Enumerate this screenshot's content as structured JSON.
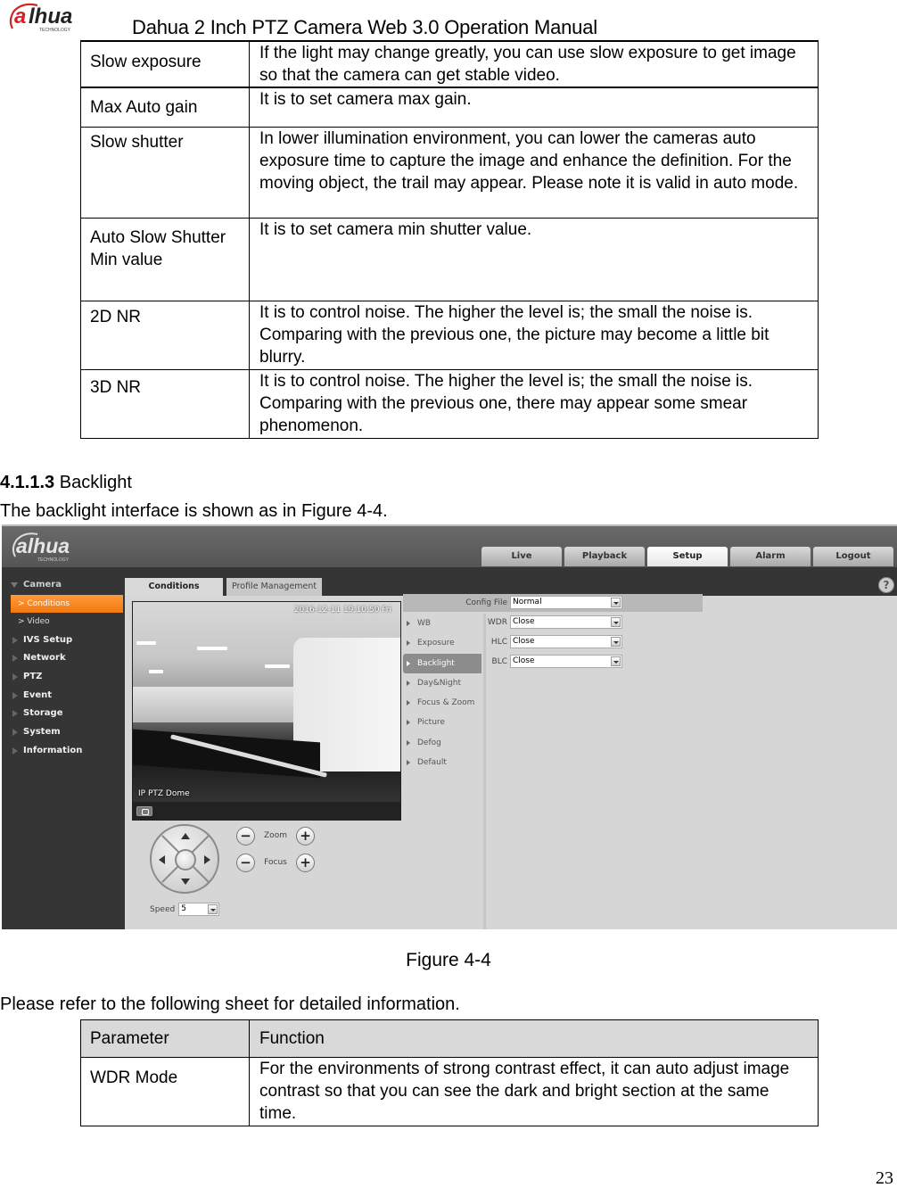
{
  "document": {
    "brand": "alhua",
    "brand_tagline": "TECHNOLOGY",
    "title": "Dahua 2 Inch PTZ Camera Web 3.0 Operation Manual",
    "page_number": "23"
  },
  "table_top": {
    "rows": [
      {
        "parameter": "Slow exposure",
        "function": "If the light may change greatly, you can use slow exposure to get image so that the camera can get stable video."
      },
      {
        "parameter": "Max Auto gain",
        "function": "It is to set camera max gain."
      },
      {
        "parameter": "Slow shutter",
        "function": "In lower illumination environment, you can lower the cameras auto exposure time to capture the image and enhance the definition. For the moving object, the trail may appear. Please note it is valid in auto mode."
      },
      {
        "parameter": "Auto Slow Shutter Min value",
        "function": "It is to set camera min shutter value."
      },
      {
        "parameter": "2D NR",
        "function": "It is to control noise. The higher the level is; the small the noise is. Comparing with the previous one, the picture may become a little bit blurry."
      },
      {
        "parameter": "3D NR",
        "function": "It is to control noise. The higher the level is; the small the noise is. Comparing with the previous one, there may appear some smear phenomenon."
      }
    ]
  },
  "section": {
    "number": "4.1.1.3",
    "title": "Backlight",
    "intro": "The backlight interface is shown as in Figure 4-4."
  },
  "figure": {
    "caption": "Figure 4-4",
    "app": {
      "logo": "alhua",
      "logo_tagline": "TECHNOLOGY",
      "nav_tabs": [
        {
          "label": "Live",
          "active": false
        },
        {
          "label": "Playback",
          "active": false
        },
        {
          "label": "Setup",
          "active": true
        },
        {
          "label": "Alarm",
          "active": false
        },
        {
          "label": "Logout",
          "active": false
        }
      ],
      "help_icon": "?",
      "sidebar": {
        "camera": "Camera",
        "camera_sub": [
          {
            "label": "Conditions",
            "active": true
          },
          {
            "label": "Video",
            "active": false
          }
        ],
        "items": [
          "IVS Setup",
          "Network",
          "PTZ",
          "Event",
          "Storage",
          "System",
          "Information"
        ]
      },
      "sub_tabs": [
        {
          "label": "Conditions",
          "active": true
        },
        {
          "label": "Profile Management",
          "active": false
        }
      ],
      "video": {
        "timestamp": "2016-12-11 19:10:50 Fri",
        "channel_label": "IP PTZ Dome"
      },
      "ptz": {
        "zoom_label": "Zoom",
        "focus_label": "Focus",
        "minus": "−",
        "plus": "+",
        "speed_label": "Speed",
        "speed_value": "5"
      },
      "condition_menu": [
        {
          "label": "WB",
          "active": false
        },
        {
          "label": "Exposure",
          "active": false
        },
        {
          "label": "Backlight",
          "active": true
        },
        {
          "label": "Day&Night",
          "active": false
        },
        {
          "label": "Focus & Zoom",
          "active": false
        },
        {
          "label": "Picture",
          "active": false
        },
        {
          "label": "Defog",
          "active": false
        },
        {
          "label": "Default",
          "active": false
        }
      ],
      "form": {
        "config_file": {
          "label": "Config File",
          "value": "Normal"
        },
        "wdr": {
          "label": "WDR",
          "value": "Close"
        },
        "hlc": {
          "label": "HLC",
          "value": "Close"
        },
        "blc": {
          "label": "BLC",
          "value": "Close"
        }
      }
    }
  },
  "refer_text": "Please refer to the following sheet for detailed information.",
  "table_bottom": {
    "headers": [
      "Parameter",
      "Function"
    ],
    "rows": [
      {
        "parameter": "WDR Mode",
        "function": "For the environments of strong contrast effect, it can auto adjust image contrast so that you can see the dark and bright section at the same time."
      }
    ]
  },
  "colors": {
    "accent_orange": "#f07a10",
    "header_gray": "#555555",
    "panel_gray": "#d6d6d6",
    "table_header_bg": "#d9d9d9"
  }
}
